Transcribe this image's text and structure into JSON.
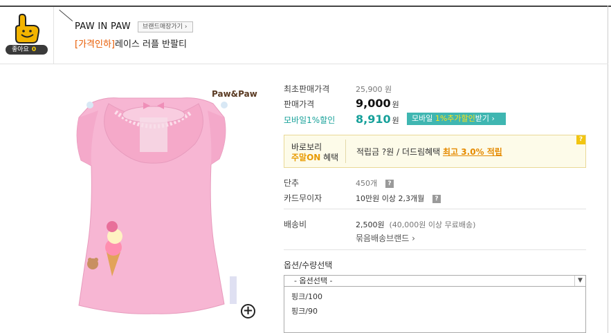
{
  "like": {
    "label": "좋아요",
    "count": "0"
  },
  "brand": {
    "name": "PAW IN PAW",
    "shop_button": "브랜드매장가기 ›"
  },
  "product": {
    "title_tag": "[가격인하]",
    "title": "레이스 러플 반팔티",
    "image_logo": "Paw&Paw"
  },
  "price": {
    "original_label": "최초판매가격",
    "original_value": "25,900 원",
    "sale_label": "판매가격",
    "sale_value": "9,000",
    "won": "원",
    "mobile_label": "모바일1%할인",
    "mobile_value": "8,910",
    "mobile_won": "원",
    "mobile_button_pre": "모바일 ",
    "mobile_button_hi": "1%추가할인",
    "mobile_button_post": "받기 ›"
  },
  "benefit": {
    "line1": "바로보리",
    "line2_hi": "주말ON",
    "line2_rest": " 혜택",
    "text": "적립금 ?원 / 더드림혜택 ",
    "link": "최고 3.0% 적립",
    "q": "?"
  },
  "stock": {
    "label": "단추",
    "value": "450개"
  },
  "installment": {
    "label": "카드무이자",
    "value": "10만원 이상 2,3개월"
  },
  "shipping": {
    "label": "배송비",
    "value": "2,500원",
    "note": "(40,000원 이상 무료배송)",
    "link": "묶음배송브랜드 ›"
  },
  "options": {
    "title": "옵션/수량선택",
    "select_value": "- 옵션선택 -",
    "items": [
      "핑크/100",
      "핑크/90"
    ]
  },
  "colors": {
    "accent_teal": "#3fb6b1",
    "orange": "#e85a00",
    "shirt_pink": "#f7b6d3"
  }
}
